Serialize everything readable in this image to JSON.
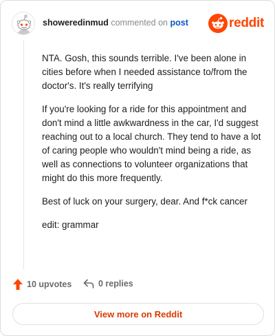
{
  "comment": {
    "username": "showeredinmud",
    "action_text": "commented on",
    "post_link": "post",
    "paragraphs": [
      "NTA. Gosh, this sounds terrible. I've been alone in cities before when I needed assistance to/from the doctor's. It's really terrifying",
      "If you're looking for a ride for this appointment and don't mind a little awkwardness in the car, I'd suggest reaching out to a local church. They tend to have a lot of caring people who wouldn't mind being a ride, as well as connections to volunteer organizations that might do this more frequently.",
      "Best of luck on your surgery, dear. And f*ck cancer",
      "edit: grammar"
    ]
  },
  "brand": {
    "name": "reddit",
    "icon": "reddit-logo-icon",
    "color": "#ff4500"
  },
  "actions": {
    "upvotes_label": "10 upvotes",
    "upvote_icon": "upvote-arrow-icon",
    "replies_label": "0 replies",
    "reply_icon": "reply-arrow-icon"
  },
  "footer": {
    "view_more_label": "View more on Reddit"
  },
  "colors": {
    "accent": "#ff4500",
    "link": "#0a56c2",
    "cta_text": "#d93a00"
  }
}
